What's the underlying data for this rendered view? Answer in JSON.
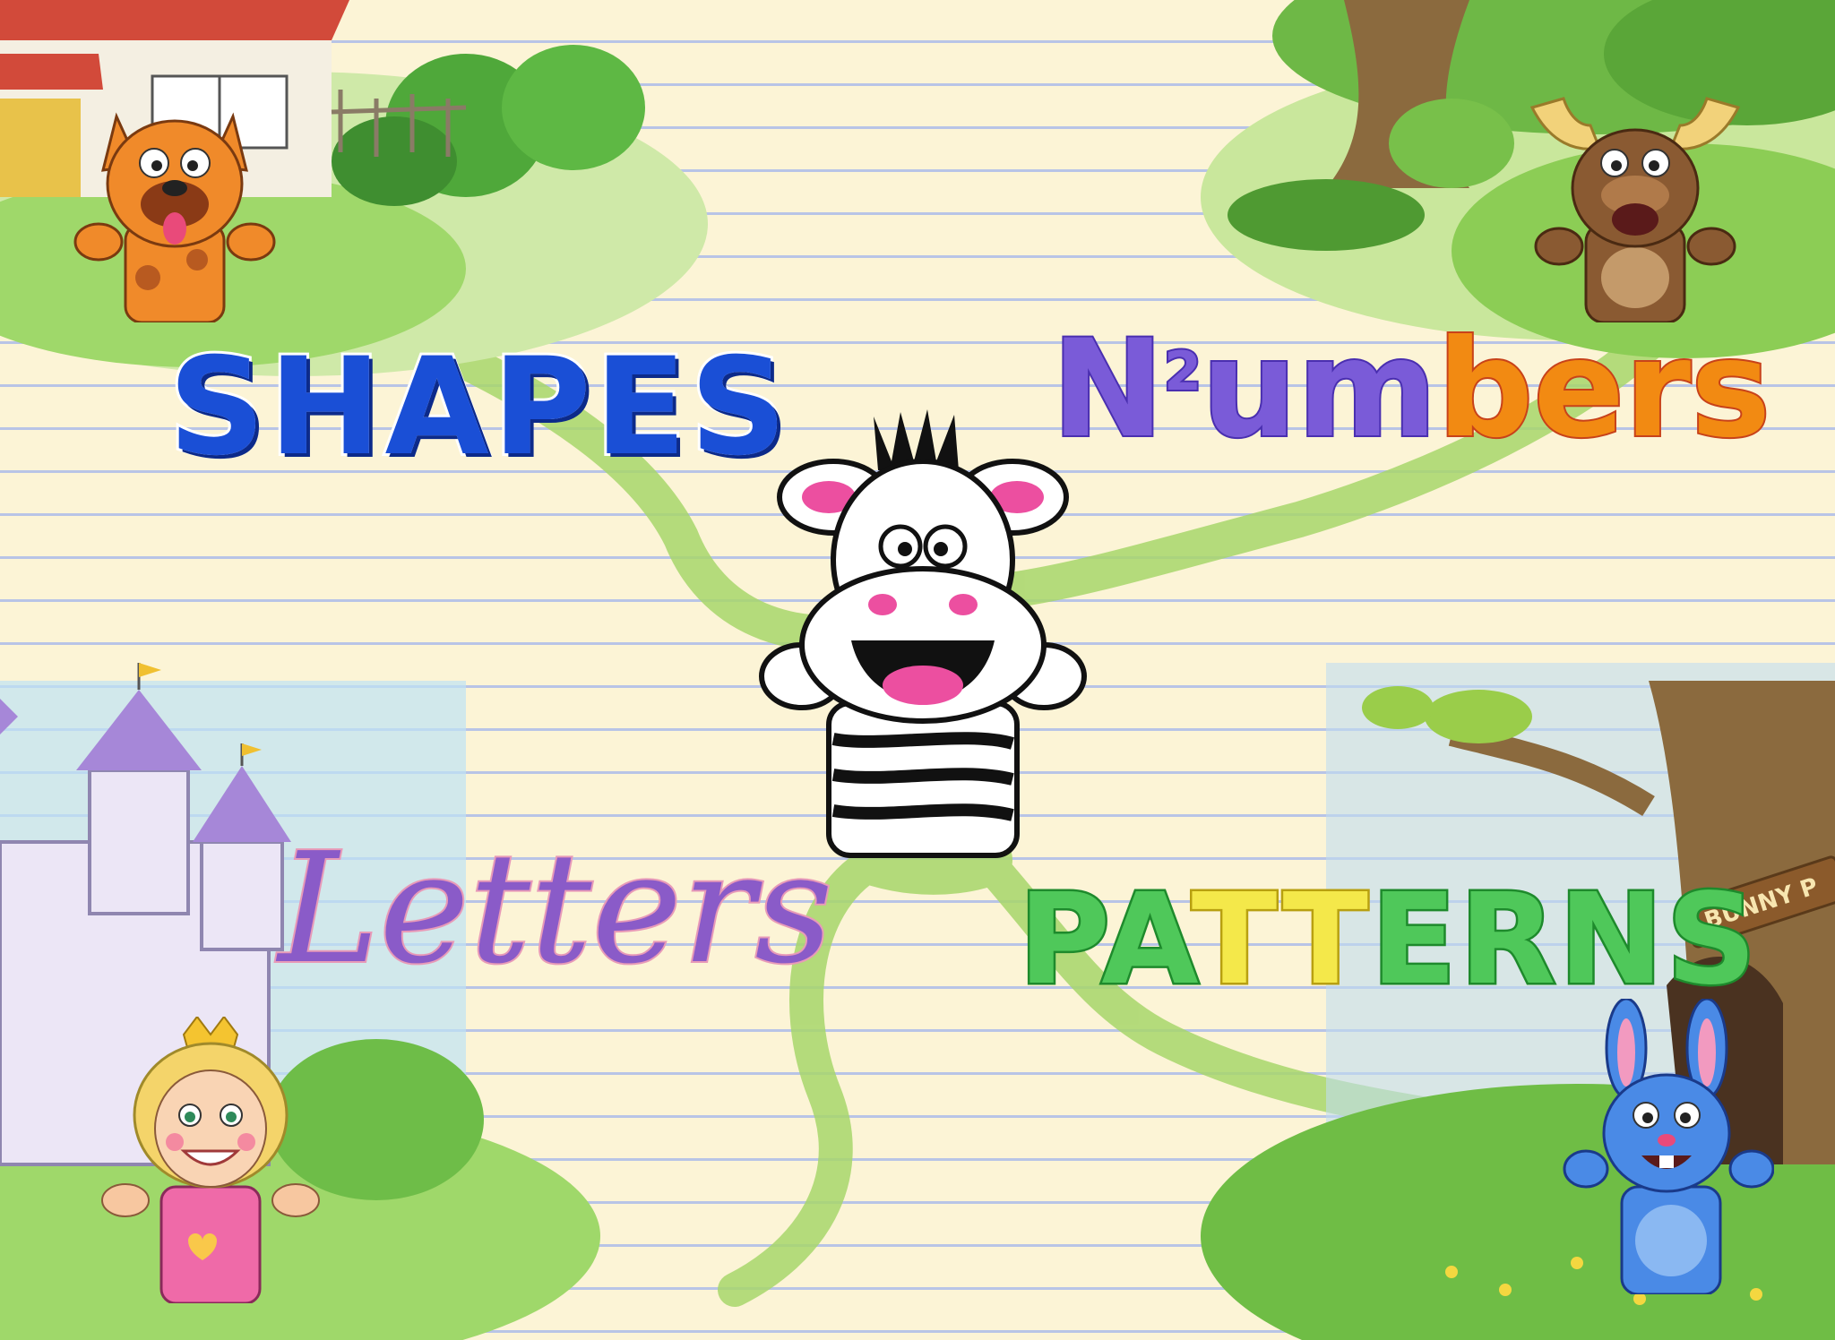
{
  "menu": {
    "shapes": {
      "label": "SHAPES"
    },
    "numbers": {
      "label_prefix": "N",
      "label_digit": "2",
      "label_mid": "um",
      "label_suffix": "bers"
    },
    "letters": {
      "label": "Letters"
    },
    "patterns": {
      "label_a": "PA",
      "label_b": "TT",
      "label_c": "ERNS"
    }
  },
  "scene": {
    "bunny_sign": "BUNNY P"
  },
  "colors": {
    "paper": "#fcf4d6",
    "rule_lines": "#b8c4e6",
    "path_green": "#a7d66b",
    "shapes_blue": "#1a4fd6",
    "numbers_orange": "#f28a12",
    "letters_purple": "#8a5bc8",
    "patterns_green": "#4fc85a"
  },
  "icons": [
    "dog-puppet-icon",
    "moose-puppet-icon",
    "zebra-puppet-icon",
    "princess-puppet-icon",
    "bunny-puppet-icon"
  ]
}
